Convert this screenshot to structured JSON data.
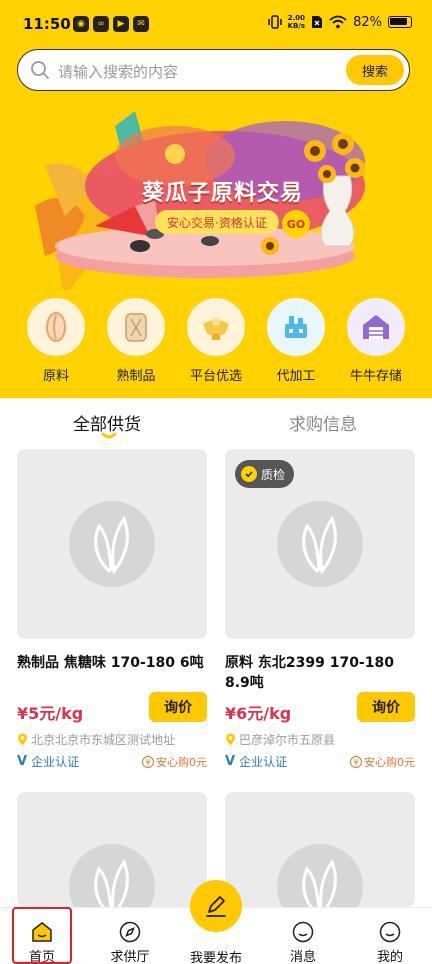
{
  "status_bar": {
    "time": "11:50",
    "speed_top": "2.00",
    "speed_bottom": "KB/s",
    "battery": "82%"
  },
  "search": {
    "placeholder": "请输入搜索的内容",
    "button": "搜索"
  },
  "banner": {
    "title": "葵瓜子原料交易",
    "subtitle": "安心交易·资格认证",
    "go": "GO"
  },
  "categories": [
    {
      "label": "原料",
      "icon": "seed-icon"
    },
    {
      "label": "熟制品",
      "icon": "roasted-seeds-icon"
    },
    {
      "label": "平台优选",
      "icon": "premium-icon"
    },
    {
      "label": "代加工",
      "icon": "factory-icon"
    },
    {
      "label": "牛牛存储",
      "icon": "warehouse-icon"
    }
  ],
  "tabs": {
    "active": "全部供货",
    "inactive": "求购信息"
  },
  "products": [
    {
      "title": "熟制品 焦糖味 170-180 6吨",
      "price": "¥5元/kg",
      "inquire": "询价",
      "address": "北京北京市东城区测试地址",
      "cert": "企业认证",
      "safe": "安心购0元"
    },
    {
      "badge": "质检",
      "title": "原料 东北2399 170-180 8.9吨",
      "price": "¥6元/kg",
      "inquire": "询价",
      "address": "巴彦淖尔市五原县",
      "cert": "企业认证",
      "safe": "安心购0元"
    }
  ],
  "nav": {
    "home": "首页",
    "hall": "求供厅",
    "publish": "我要发布",
    "messages": "消息",
    "mine": "我的"
  },
  "colors": {
    "brand_yellow": "#FFD200",
    "button_yellow": "#FFC800",
    "price_red": "#E0334B",
    "cert_blue": "#2E7BB8",
    "highlight_red": "#E0202A"
  }
}
